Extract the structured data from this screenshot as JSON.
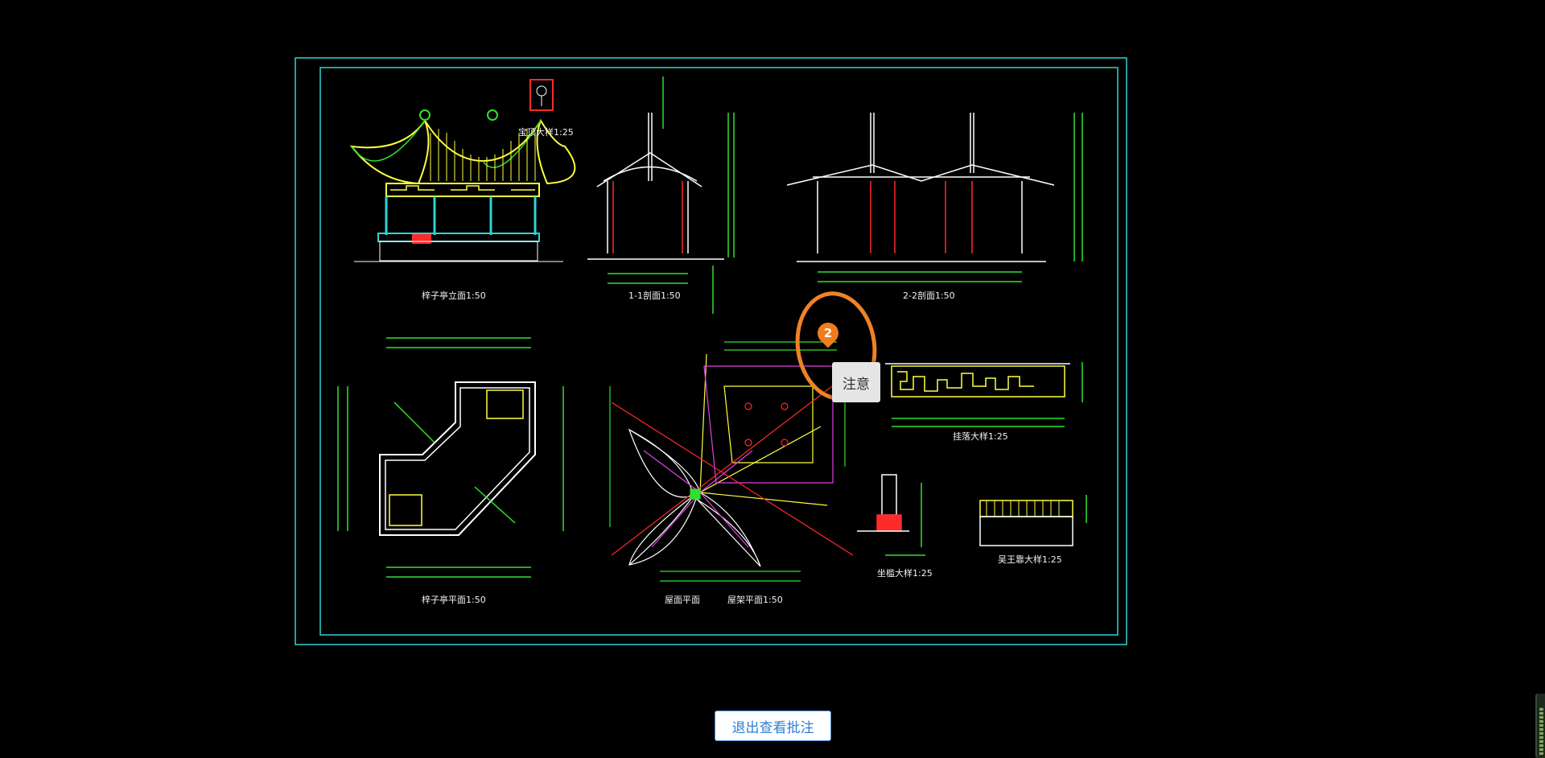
{
  "drawing": {
    "labels": {
      "elevation": "梓子亭立面1:50",
      "finial_detail": "宝顶大样1:25",
      "section_1": "1-1剖面1:50",
      "section_2": "2-2剖面1:50",
      "plan": "梓子亭平面1:50",
      "roof_plan": "屋面平面",
      "roof_frame_plan": "屋架平面1:50",
      "hanging_fascia_detail": "挂落大样1:25",
      "seat_detail": "坐槛大样1:25",
      "wuwangkao_detail": "吴王靠大样1:25"
    },
    "colors": {
      "frame": "#2fd3d3",
      "dimension": "#30e030",
      "structure": "#ffff40",
      "section_cut": "#ff2a2a",
      "roof_lines": "#e040e0",
      "outline": "#ffffff"
    }
  },
  "annotation": {
    "number": "2",
    "tooltip": "注意",
    "color": "#f08226"
  },
  "exit_button": {
    "label": "退出查看批注"
  }
}
